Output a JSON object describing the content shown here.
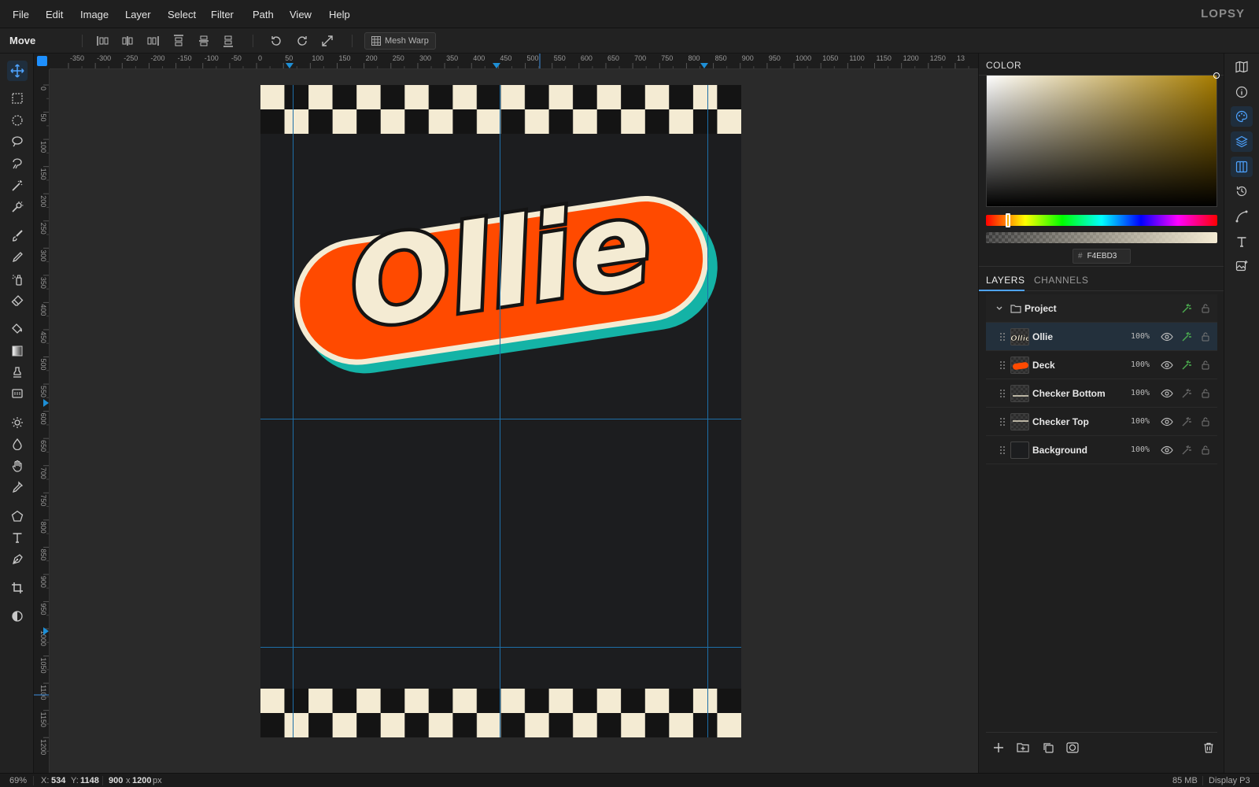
{
  "menu": {
    "items": [
      "File",
      "Edit",
      "Image",
      "Layer",
      "Select",
      "Filter",
      "Path",
      "View",
      "Help"
    ],
    "brand": "LOPSY"
  },
  "options": {
    "tool_name": "Move",
    "mesh_warp_label": "Mesh Warp"
  },
  "rulers": {
    "horizontal_labels": [
      "-350",
      "-300",
      "-250",
      "-200",
      "-150",
      "-100",
      "-50",
      "0",
      "50",
      "100",
      "150",
      "200",
      "250",
      "300",
      "350",
      "400",
      "450",
      "500",
      "550",
      "600",
      "650",
      "700",
      "750",
      "800",
      "850",
      "900",
      "950",
      "1000",
      "1050",
      "1100",
      "1150",
      "1200",
      "1250",
      "13"
    ],
    "vertical_labels": [
      "0",
      "50",
      "100",
      "150",
      "200",
      "250",
      "300",
      "350",
      "400",
      "450",
      "500",
      "550",
      "600",
      "650",
      "700",
      "750",
      "800",
      "850",
      "900",
      "950",
      "1000",
      "1050",
      "1100",
      "1150",
      "1200"
    ]
  },
  "artwork": {
    "title_text": "Ollie",
    "colors": {
      "cream": "#F4EBD3",
      "dark": "#141414",
      "orange": "#FF4A00",
      "teal": "#14B3A6",
      "background": "#1C1D1F",
      "guide": "#1E6FA8"
    }
  },
  "color_panel": {
    "tab_label": "COLOR",
    "hex_prefix": "#",
    "hex_value": "F4EBD3"
  },
  "layers_panel": {
    "tabs": [
      "LAYERS",
      "CHANNELS"
    ],
    "group_name": "Project",
    "layers": [
      {
        "name": "Ollie",
        "opacity": "100%",
        "selected": true
      },
      {
        "name": "Deck",
        "opacity": "100%",
        "selected": false
      },
      {
        "name": "Checker Bottom",
        "opacity": "100%",
        "selected": false
      },
      {
        "name": "Checker Top",
        "opacity": "100%",
        "selected": false
      },
      {
        "name": "Background",
        "opacity": "100%",
        "selected": false
      }
    ]
  },
  "status": {
    "zoom": "69%",
    "x_label": "X:",
    "x_value": "534",
    "y_label": "Y:",
    "y_value": "1148",
    "doc_w": "900",
    "doc_x": "x",
    "doc_h": "1200",
    "doc_unit": "px",
    "memory": "85 MB",
    "color_profile": "Display P3"
  }
}
